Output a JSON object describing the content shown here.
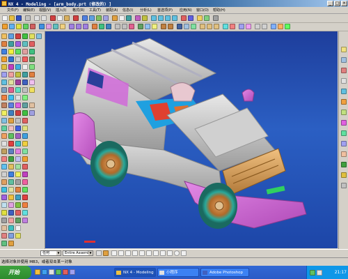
{
  "window": {
    "title": "NX 4 - Modeling - [arm_body.prt  (修改的) ]",
    "minimize": "_",
    "maximize": "□",
    "close": "×"
  },
  "menu": {
    "items": [
      "文件(F)",
      "编辑(E)",
      "视图(V)",
      "插入(I)",
      "格式(R)",
      "工具(T)",
      "装配(A)",
      "信息(I)",
      "分析(L)",
      "首选项(P)",
      "应用(N)",
      "窗口(O)",
      "帮助(H)"
    ]
  },
  "selection_bar": {
    "filter_value": "任何",
    "scope_value": "Entire Assembl"
  },
  "status": {
    "prompt": "选择对象并使用 MB3，或者双击某一对象"
  },
  "taskbar": {
    "start_label": "开始",
    "tasks": [
      "NX 4 - Modeling",
      "小程序",
      "Adobe Photoshop"
    ],
    "clock": "21:17"
  },
  "colors": {
    "title_bar": "#0a246a",
    "viewport_top": "#1e3e9c",
    "viewport_bottom": "#1d46a8",
    "body_gray": "#c8c8c8",
    "accent_magenta": "#d46ad8",
    "accent_gold": "#d9a25a",
    "rim_teal": "#2aa89a",
    "grille_green": "#30d060"
  }
}
